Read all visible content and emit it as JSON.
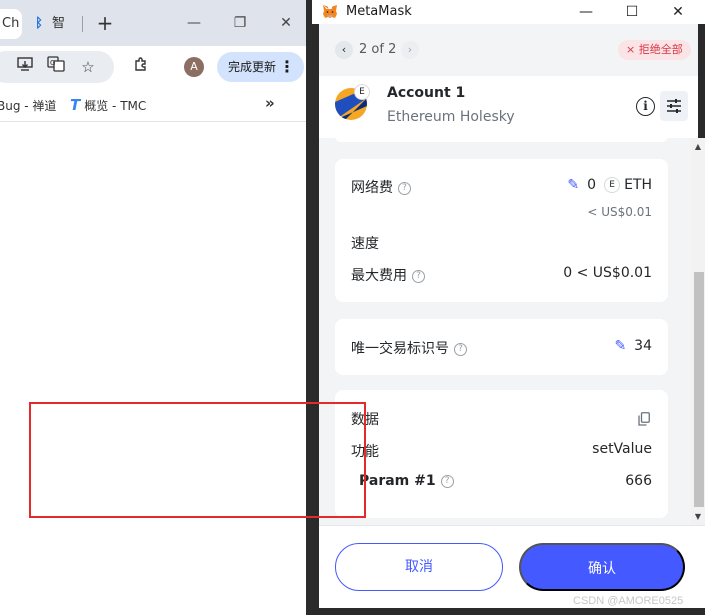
{
  "chrome": {
    "tab_partial": "Ch",
    "tab2_label": "智",
    "new_tab": "+",
    "minimize": "—",
    "restore": "❐",
    "close": "✕",
    "avatar_letter": "A",
    "update_label": "完成更新",
    "bookmark1": "Bug - 禅道",
    "bookmark2": "概览 - TMC",
    "bookmarks_more": "»"
  },
  "metamask": {
    "title": "MetaMask",
    "pager": {
      "text": "2 of 2",
      "prev": "‹",
      "next": "›",
      "reject_all": "拒绝全部"
    },
    "account": {
      "name": "Account 1",
      "network": "Ethereum Holesky",
      "network_badge": "E"
    },
    "fees": {
      "network_fee_label": "网络费",
      "network_fee_value": "0",
      "network_fee_badge": "E",
      "network_fee_unit": "ETH",
      "network_fee_fiat": "< US$0.01",
      "speed_label": "速度",
      "max_fee_label": "最大费用",
      "max_fee_value": "0 < US$0.01"
    },
    "nonce": {
      "label": "唯一交易标识号",
      "value": "34"
    },
    "data": {
      "label": "数据",
      "function_label": "功能",
      "function_value": "setValue",
      "param_label": "Param #1",
      "param_value": "666"
    },
    "footer": {
      "cancel": "取消",
      "confirm": "确认"
    },
    "colors": {
      "primary": "#4459ff",
      "danger": "#d73847",
      "highlight": "#e32b2b"
    }
  },
  "watermark": "CSDN @AMORE0525"
}
